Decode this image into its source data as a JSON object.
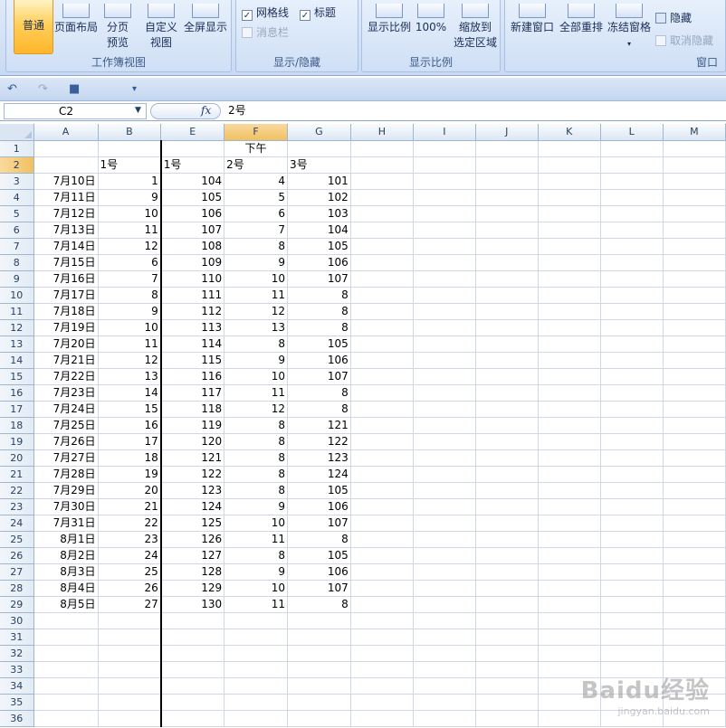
{
  "ribbon": {
    "workbook_views": {
      "label": "工作簿视图",
      "buttons": [
        {
          "name": "normal",
          "label": "普通"
        },
        {
          "name": "page-layout",
          "label": "页面布局"
        },
        {
          "name": "page-break-preview",
          "label_line1": "分页",
          "label_line2": "预览"
        },
        {
          "name": "custom-views",
          "label_line1": "自定义",
          "label_line2": "视图"
        },
        {
          "name": "full-screen",
          "label": "全屏显示"
        }
      ]
    },
    "show_hide": {
      "label": "显示/隐藏",
      "gridlines": {
        "label": "网格线",
        "checked": true
      },
      "headings": {
        "label": "标题",
        "checked": true
      },
      "message_bar": {
        "label": "消息栏",
        "checked": false,
        "disabled": true
      }
    },
    "zoom": {
      "label": "显示比例",
      "zoom_button": "显示比例",
      "hundred_button": "100%",
      "zoom_selection_line1": "缩放到",
      "zoom_selection_line2": "选定区域"
    },
    "window": {
      "label": "窗口",
      "new_window": "新建窗口",
      "arrange_all": "全部重排",
      "freeze_panes": "冻结窗格",
      "hide": "隐藏",
      "unhide": "取消隐藏"
    }
  },
  "quick_access": {
    "undo": "↶",
    "redo": "↷",
    "save": "■",
    "customize": "▾"
  },
  "formula_bar": {
    "name_box": "C2",
    "fx": "fx",
    "content": "2号"
  },
  "sheet": {
    "columns": [
      "A",
      "B",
      "E",
      "F",
      "G",
      "H",
      "I",
      "J",
      "K",
      "L",
      "M"
    ],
    "active_column": "F",
    "active_row": 2,
    "header_row1_merged": "下午",
    "header_row2": {
      "B": "1号",
      "E": "1号",
      "F": "2号",
      "G": "3号"
    },
    "rows": [
      {
        "A": "7月10日",
        "B": "1",
        "E": "104",
        "F": "4",
        "G": "101"
      },
      {
        "A": "7月11日",
        "B": "9",
        "E": "105",
        "F": "5",
        "G": "102"
      },
      {
        "A": "7月12日",
        "B": "10",
        "E": "106",
        "F": "6",
        "G": "103"
      },
      {
        "A": "7月13日",
        "B": "11",
        "E": "107",
        "F": "7",
        "G": "104"
      },
      {
        "A": "7月14日",
        "B": "12",
        "E": "108",
        "F": "8",
        "G": "105"
      },
      {
        "A": "7月15日",
        "B": "6",
        "E": "109",
        "F": "9",
        "G": "106"
      },
      {
        "A": "7月16日",
        "B": "7",
        "E": "110",
        "F": "10",
        "G": "107"
      },
      {
        "A": "7月17日",
        "B": "8",
        "E": "111",
        "F": "11",
        "G": "8"
      },
      {
        "A": "7月18日",
        "B": "9",
        "E": "112",
        "F": "12",
        "G": "8"
      },
      {
        "A": "7月19日",
        "B": "10",
        "E": "113",
        "F": "13",
        "G": "8"
      },
      {
        "A": "7月20日",
        "B": "11",
        "E": "114",
        "F": "8",
        "G": "105"
      },
      {
        "A": "7月21日",
        "B": "12",
        "E": "115",
        "F": "9",
        "G": "106"
      },
      {
        "A": "7月22日",
        "B": "13",
        "E": "116",
        "F": "10",
        "G": "107"
      },
      {
        "A": "7月23日",
        "B": "14",
        "E": "117",
        "F": "11",
        "G": "8"
      },
      {
        "A": "7月24日",
        "B": "15",
        "E": "118",
        "F": "12",
        "G": "8"
      },
      {
        "A": "7月25日",
        "B": "16",
        "E": "119",
        "F": "8",
        "G": "121"
      },
      {
        "A": "7月26日",
        "B": "17",
        "E": "120",
        "F": "8",
        "G": "122"
      },
      {
        "A": "7月27日",
        "B": "18",
        "E": "121",
        "F": "8",
        "G": "123"
      },
      {
        "A": "7月28日",
        "B": "19",
        "E": "122",
        "F": "8",
        "G": "124"
      },
      {
        "A": "7月29日",
        "B": "20",
        "E": "123",
        "F": "8",
        "G": "105"
      },
      {
        "A": "7月30日",
        "B": "21",
        "E": "124",
        "F": "9",
        "G": "106"
      },
      {
        "A": "7月31日",
        "B": "22",
        "E": "125",
        "F": "10",
        "G": "107"
      },
      {
        "A": "8月1日",
        "B": "23",
        "E": "126",
        "F": "11",
        "G": "8"
      },
      {
        "A": "8月2日",
        "B": "24",
        "E": "127",
        "F": "8",
        "G": "105"
      },
      {
        "A": "8月3日",
        "B": "25",
        "E": "128",
        "F": "9",
        "G": "106"
      },
      {
        "A": "8月4日",
        "B": "26",
        "E": "129",
        "F": "10",
        "G": "107"
      },
      {
        "A": "8月5日",
        "B": "27",
        "E": "130",
        "F": "11",
        "G": "8"
      }
    ],
    "row_numbers": [
      "1",
      "2",
      "3",
      "4",
      "5",
      "6",
      "7",
      "8",
      "9",
      "10",
      "11",
      "12",
      "13",
      "14",
      "15",
      "16",
      "17",
      "18",
      "19",
      "20",
      "21",
      "22",
      "23",
      "24",
      "25",
      "26",
      "27",
      "28",
      "29",
      "30",
      "31",
      "32",
      "33",
      "34",
      "35",
      "36"
    ]
  },
  "watermark": {
    "brand": "Baidu经验",
    "url": "jingyan.baidu.com"
  }
}
